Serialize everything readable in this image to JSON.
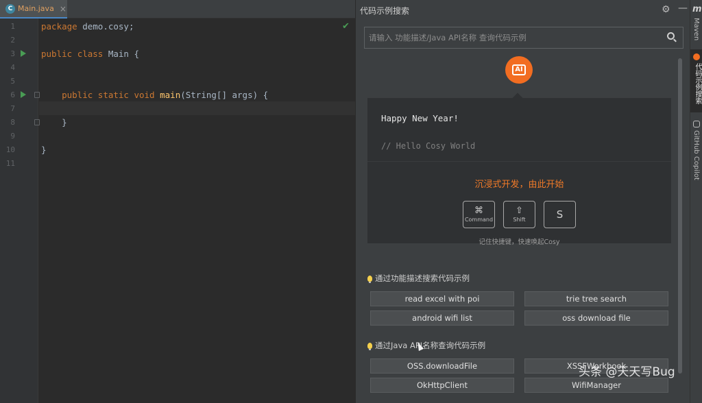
{
  "editor": {
    "tab": {
      "icon_label": "C",
      "label": "Main.java",
      "close": "×"
    },
    "status_check": "✔",
    "lines": [
      {
        "n": "1",
        "code": [
          {
            "t": "package",
            "c": "kw"
          },
          {
            "t": " demo.cosy;",
            "c": ""
          }
        ]
      },
      {
        "n": "2",
        "code": []
      },
      {
        "n": "3",
        "code": [
          {
            "t": "public",
            "c": "kw"
          },
          {
            "t": " ",
            "c": ""
          },
          {
            "t": "class",
            "c": "kw"
          },
          {
            "t": " Main {",
            "c": ""
          }
        ]
      },
      {
        "n": "4",
        "code": []
      },
      {
        "n": "5",
        "code": []
      },
      {
        "n": "6",
        "code": [
          {
            "t": "    public",
            "c": "kw"
          },
          {
            "t": " ",
            "c": ""
          },
          {
            "t": "static",
            "c": "kw"
          },
          {
            "t": " ",
            "c": ""
          },
          {
            "t": "void",
            "c": "kw"
          },
          {
            "t": " ",
            "c": ""
          },
          {
            "t": "main",
            "c": "fn"
          },
          {
            "t": "(String[] args) {",
            "c": ""
          }
        ]
      },
      {
        "n": "7",
        "code": []
      },
      {
        "n": "8",
        "code": [
          {
            "t": "    }",
            "c": ""
          }
        ]
      },
      {
        "n": "9",
        "code": []
      },
      {
        "n": "10",
        "code": [
          {
            "t": "}",
            "c": ""
          }
        ]
      },
      {
        "n": "11",
        "code": []
      }
    ]
  },
  "panel": {
    "title": "代码示例搜索",
    "settings_icon": "gear-icon",
    "minimize_icon": "minus-icon",
    "search": {
      "placeholder": "请输入 功能描述/Java API名称 查询代码示例",
      "value": ""
    },
    "logo_text": "AI",
    "card": {
      "greeting": "Happy New Year!",
      "comment": "// Hello Cosy World",
      "slogan": "沉浸式开发，由此开始",
      "keys": [
        {
          "symbol": "⌘",
          "caption": "Command"
        },
        {
          "symbol": "⇧",
          "caption": "Shift"
        },
        {
          "symbol": "S",
          "caption": ""
        }
      ],
      "hint": "记住快捷键，快速唤起Cosy"
    },
    "section_desc": {
      "title": "通过功能描述搜索代码示例",
      "chips": [
        "read excel with poi",
        "trie tree search",
        "android wifi list",
        "oss download file"
      ]
    },
    "section_api": {
      "title": "通过Java API名称查询代码示例",
      "chips": [
        "OSS.downloadFile",
        "XSSFWorkbook",
        "OkHttpClient",
        "WifiManager"
      ]
    }
  },
  "stripe": {
    "maven": "Maven",
    "cosy_search": "代码示例搜索",
    "copilot": "GitHub Copilot",
    "m_logo": "m"
  },
  "watermark": "头条 @天天写Bug",
  "colors": {
    "accent_orange": "#f26d21",
    "editor_bg": "#2b2b2b",
    "panel_bg": "#3c3f41",
    "keyword": "#cc7832",
    "function": "#ffc66d"
  }
}
